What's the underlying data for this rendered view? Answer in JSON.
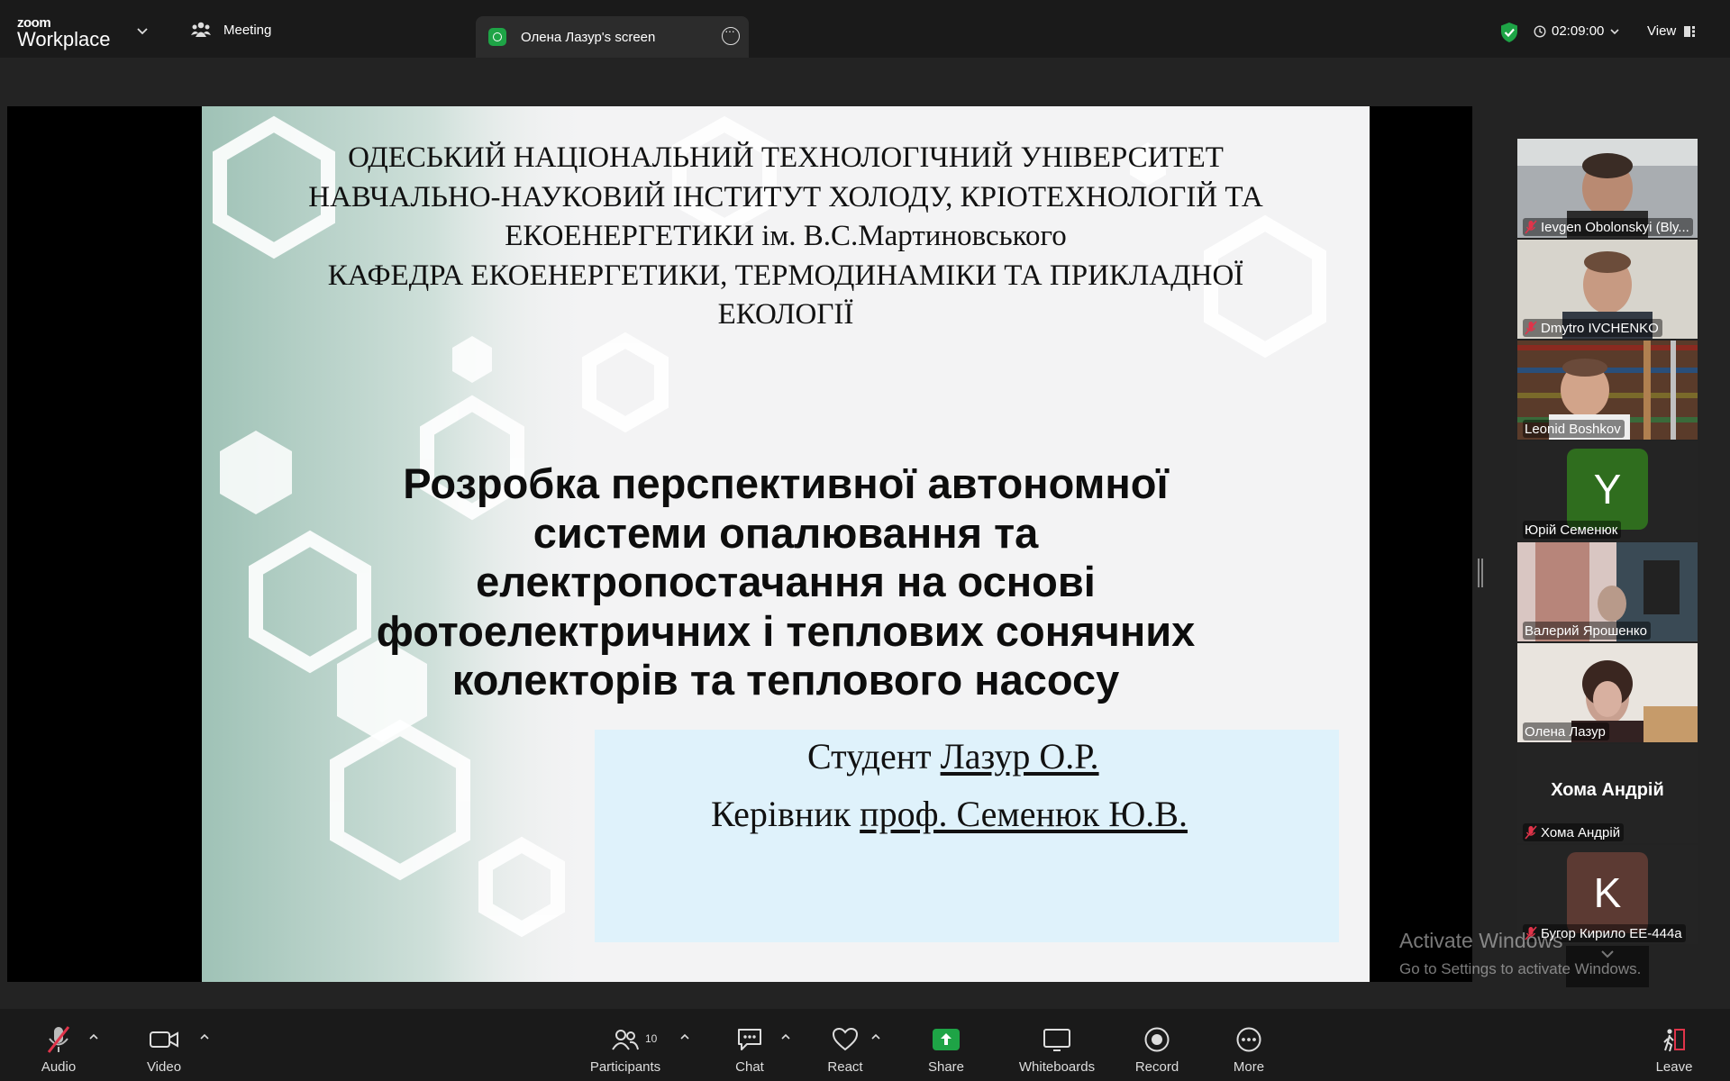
{
  "topbar": {
    "logo_small": "zoom",
    "logo_big": "Workplace",
    "meeting_label": "Meeting",
    "screen_tab_label": "Олена Лазур's screen",
    "timer": "02:09:00",
    "view_label": "View"
  },
  "slide": {
    "university_lines": [
      "ОДЕСЬКИЙ НАЦІОНАЛЬНИЙ ТЕХНОЛОГІЧНИЙ УНІВЕРСИТЕТ",
      "НАВЧАЛЬНО-НАУКОВИЙ ІНСТИТУТ ХОЛОДУ, КРІОТЕХНОЛОГІЙ ТА",
      "ЕКОЕНЕРГЕТИКИ ім. В.С.Мартиновського",
      "КАФЕДРА ЕКОЕНЕРГЕТИКИ, ТЕРМОДИНАМІКИ ТА ПРИКЛАДНОЇ",
      "ЕКОЛОГІЇ"
    ],
    "title_lines": [
      "Розробка перспективної автономної",
      "системи опалювання та",
      "електропостачання на основі",
      "фотоелектричних і теплових сонячних",
      "колекторів та теплового насосу"
    ],
    "student_label": "Студент",
    "student_name": "Лазур О.Р.",
    "supervisor_label": "Керівник",
    "supervisor_name": "проф. Семенюк Ю.В."
  },
  "participants": [
    {
      "name": "Ievgen Obolonskyi (Bly...",
      "muted": true,
      "kind": "video"
    },
    {
      "name": "Dmytro IVCHENKO",
      "muted": true,
      "kind": "video"
    },
    {
      "name": "Leonid Boshkov",
      "muted": false,
      "kind": "video"
    },
    {
      "name": "Юрій Семенюк",
      "muted": false,
      "kind": "avatar",
      "initial": "Y",
      "color": "#2f6d1e"
    },
    {
      "name": "Валерий Ярошенко",
      "muted": false,
      "kind": "video"
    },
    {
      "name": "Олена Лазур",
      "muted": false,
      "kind": "video",
      "active": true
    },
    {
      "name": "Хома Андрій",
      "muted": true,
      "kind": "text",
      "display": "Хома Андрій"
    },
    {
      "name": "Бугор Кирило ЕЕ-444а",
      "muted": true,
      "kind": "avatar",
      "initial": "K",
      "color": "#5c3a33"
    }
  ],
  "watermark": {
    "line1": "Activate Windows",
    "line2": "Go to Settings to activate Windows."
  },
  "toolbar": {
    "audio": "Audio",
    "video": "Video",
    "participants": "Participants",
    "participants_count": "10",
    "chat": "Chat",
    "react": "React",
    "share": "Share",
    "whiteboards": "Whiteboards",
    "record": "Record",
    "more": "More",
    "leave": "Leave"
  },
  "colors": {
    "accent_green": "#1ea446",
    "active_speaker": "#1ed06c",
    "mute_red": "#e0344a",
    "credits_bg": "#dff2fb"
  }
}
